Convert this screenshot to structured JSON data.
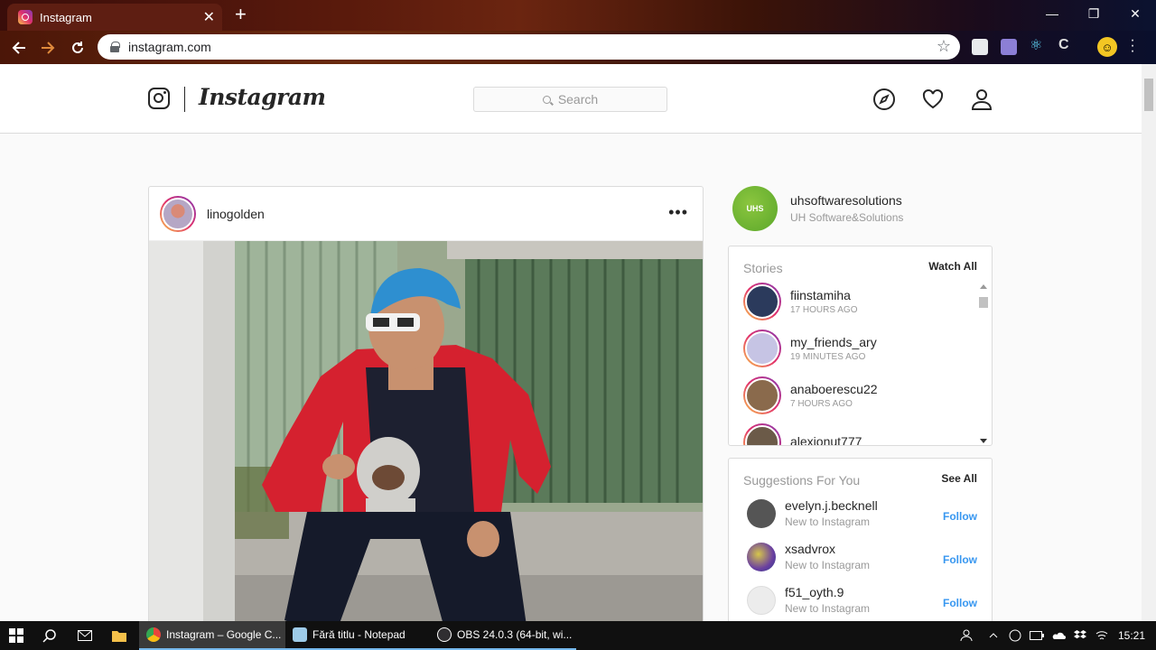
{
  "browser": {
    "tab_title": "Instagram",
    "url": "instagram.com"
  },
  "header": {
    "wordmark": "Instagram",
    "search_placeholder": "Search"
  },
  "post": {
    "username": "linogolden",
    "more": "•••"
  },
  "sidebar": {
    "account": {
      "username": "uhsoftwaresolutions",
      "display_name": "UH Software&Solutions"
    },
    "stories": {
      "title": "Stories",
      "action": "Watch All",
      "items": [
        {
          "username": "fiinstamiha",
          "time": "17 HOURS AGO",
          "color": "#2b3a5c"
        },
        {
          "username": "my_friends_ary",
          "time": "19 MINUTES AGO",
          "color": "#c6c4e4"
        },
        {
          "username": "anaboerescu22",
          "time": "7 HOURS AGO",
          "color": "#8a6a4c"
        },
        {
          "username": "alexionut777",
          "time": "",
          "color": "#6b5a48"
        }
      ]
    },
    "suggestions": {
      "title": "Suggestions For You",
      "action": "See All",
      "items": [
        {
          "username": "evelyn.j.becknell",
          "sub": "New to Instagram",
          "action": "Follow",
          "color": "#555555"
        },
        {
          "username": "xsadvrox",
          "sub": "New to Instagram",
          "action": "Follow",
          "color": "#6a3fa0"
        },
        {
          "username": "f51_oyth.9",
          "sub": "New to Instagram",
          "action": "Follow",
          "color": "#dddddd"
        }
      ]
    }
  },
  "taskbar": {
    "apps": [
      {
        "label": "Instagram – Google C...",
        "color": "#e8453c"
      },
      {
        "label": "Fără titlu - Notepad",
        "color": "#9ecbe8"
      },
      {
        "label": "OBS 24.0.3 (64-bit, wi...",
        "color": "#302e31"
      }
    ],
    "time": "15:21"
  }
}
